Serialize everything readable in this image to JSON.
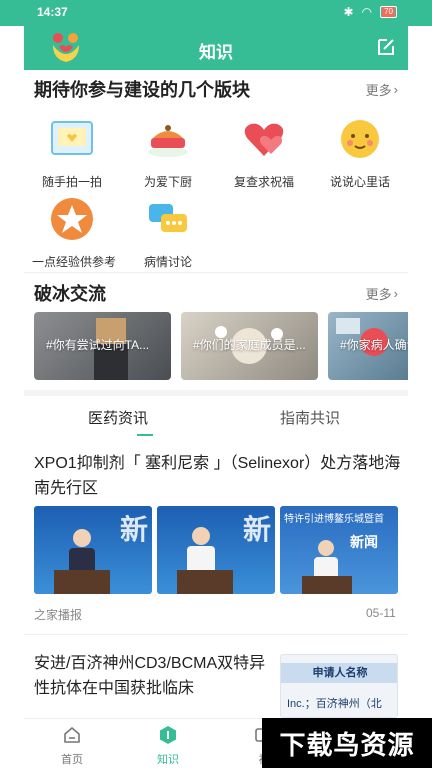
{
  "status_bar": {
    "time": "14:37",
    "battery": "70"
  },
  "header": {
    "title": "知识"
  },
  "sections": {
    "modules": {
      "title": "期待你参与建设的几个版块",
      "more": "更多",
      "items": [
        {
          "label": "随手拍一拍",
          "icon": "photo-frame-icon"
        },
        {
          "label": "为爱下厨",
          "icon": "cooking-pot-icon"
        },
        {
          "label": "复查求祝福",
          "icon": "hearts-icon"
        },
        {
          "label": "说说心里话",
          "icon": "smiley-face-icon"
        },
        {
          "label": "一点经验供参考",
          "icon": "star-icon"
        },
        {
          "label": "病情讨论",
          "icon": "chat-bubbles-icon"
        }
      ]
    },
    "icebreak": {
      "title": "破冰交流",
      "more": "更多",
      "cards": [
        {
          "text": "#你有尝试过向TA..."
        },
        {
          "text": "#你们的家庭成员是..."
        },
        {
          "text": "#你家病人确诊..."
        }
      ]
    }
  },
  "tabs": [
    {
      "label": "医药资讯",
      "active": true
    },
    {
      "label": "指南共识",
      "active": false
    }
  ],
  "articles": [
    {
      "title_lines": [
        "XPO1抑制剂「 塞利尼索 」（Selinexor）处方落地海",
        "南先行区"
      ],
      "thumb_overlays": [
        "新",
        "新",
        "特许引进博鳌乐城暨首",
        "新闻"
      ],
      "source": "之家播报",
      "date": "05-11"
    },
    {
      "title_lines": [
        "安进/百济神州CD3/BCMA双特异",
        "性抗体在中国获批临床"
      ],
      "thumb_overlays": [
        "申请人名称",
        "Inc.；百济神州（北"
      ]
    }
  ],
  "bottom_nav": [
    {
      "label": "首页",
      "icon": "home-icon",
      "active": false
    },
    {
      "label": "知识",
      "icon": "knowledge-icon",
      "active": true
    },
    {
      "label": "视",
      "icon": "video-icon",
      "active": false
    }
  ],
  "watermark": "下载鸟资源",
  "colors": {
    "accent": "#37bd95"
  }
}
